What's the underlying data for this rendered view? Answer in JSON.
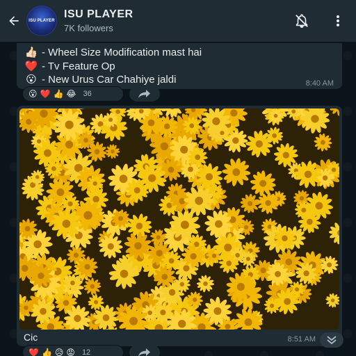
{
  "header": {
    "back_icon": "arrow-left-icon",
    "avatar_text": "ISU PLAYER",
    "channel_name": "ISU PLAYER",
    "followers": "7K followers",
    "mute_icon": "bell-off-icon",
    "menu_icon": "more-vertical-icon"
  },
  "messages": [
    {
      "lines": [
        {
          "emoji": "👍🏻",
          "text": "- Wheel Size Modification mast hai"
        },
        {
          "emoji": "❤️",
          "text": "- Tv Feature Op"
        },
        {
          "emoji": "😮",
          "text": "- New Urus Car Chahiye jaldi"
        }
      ],
      "time": "8:40 AM",
      "reactions": {
        "emojis": [
          "😮",
          "❤️",
          "👍",
          "😂"
        ],
        "count": "36"
      }
    },
    {
      "image_desc_icon": "photo",
      "caption": "Cic",
      "time": "8:51 AM",
      "reactions": {
        "emojis": [
          "❤️",
          "👍",
          "😥",
          "😡"
        ],
        "count": "12"
      }
    }
  ],
  "colors": {
    "header_bg": "#1f2c34",
    "chat_bg": "#0b141a",
    "bubble_bg": "#1f2c34",
    "text": "#e9edef",
    "muted": "#8696a0",
    "flower": "#f2c20c"
  }
}
